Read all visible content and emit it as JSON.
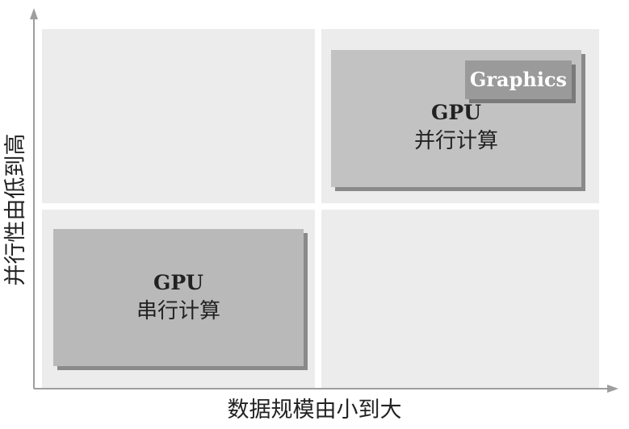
{
  "diagram": {
    "x_axis_label": "数据规模由小到大",
    "y_axis_label": "并行性由低到高",
    "parallel_box": {
      "line1": "GPU",
      "line2": "并行计算",
      "tag": "Graphics"
    },
    "serial_box": {
      "line1": "GPU",
      "line2": "串行计算"
    }
  },
  "colors": {
    "quadrant": "#ececec",
    "box": "#c2c2c2",
    "tag": "#9a9a9a",
    "axis": "#9e9e9e"
  }
}
